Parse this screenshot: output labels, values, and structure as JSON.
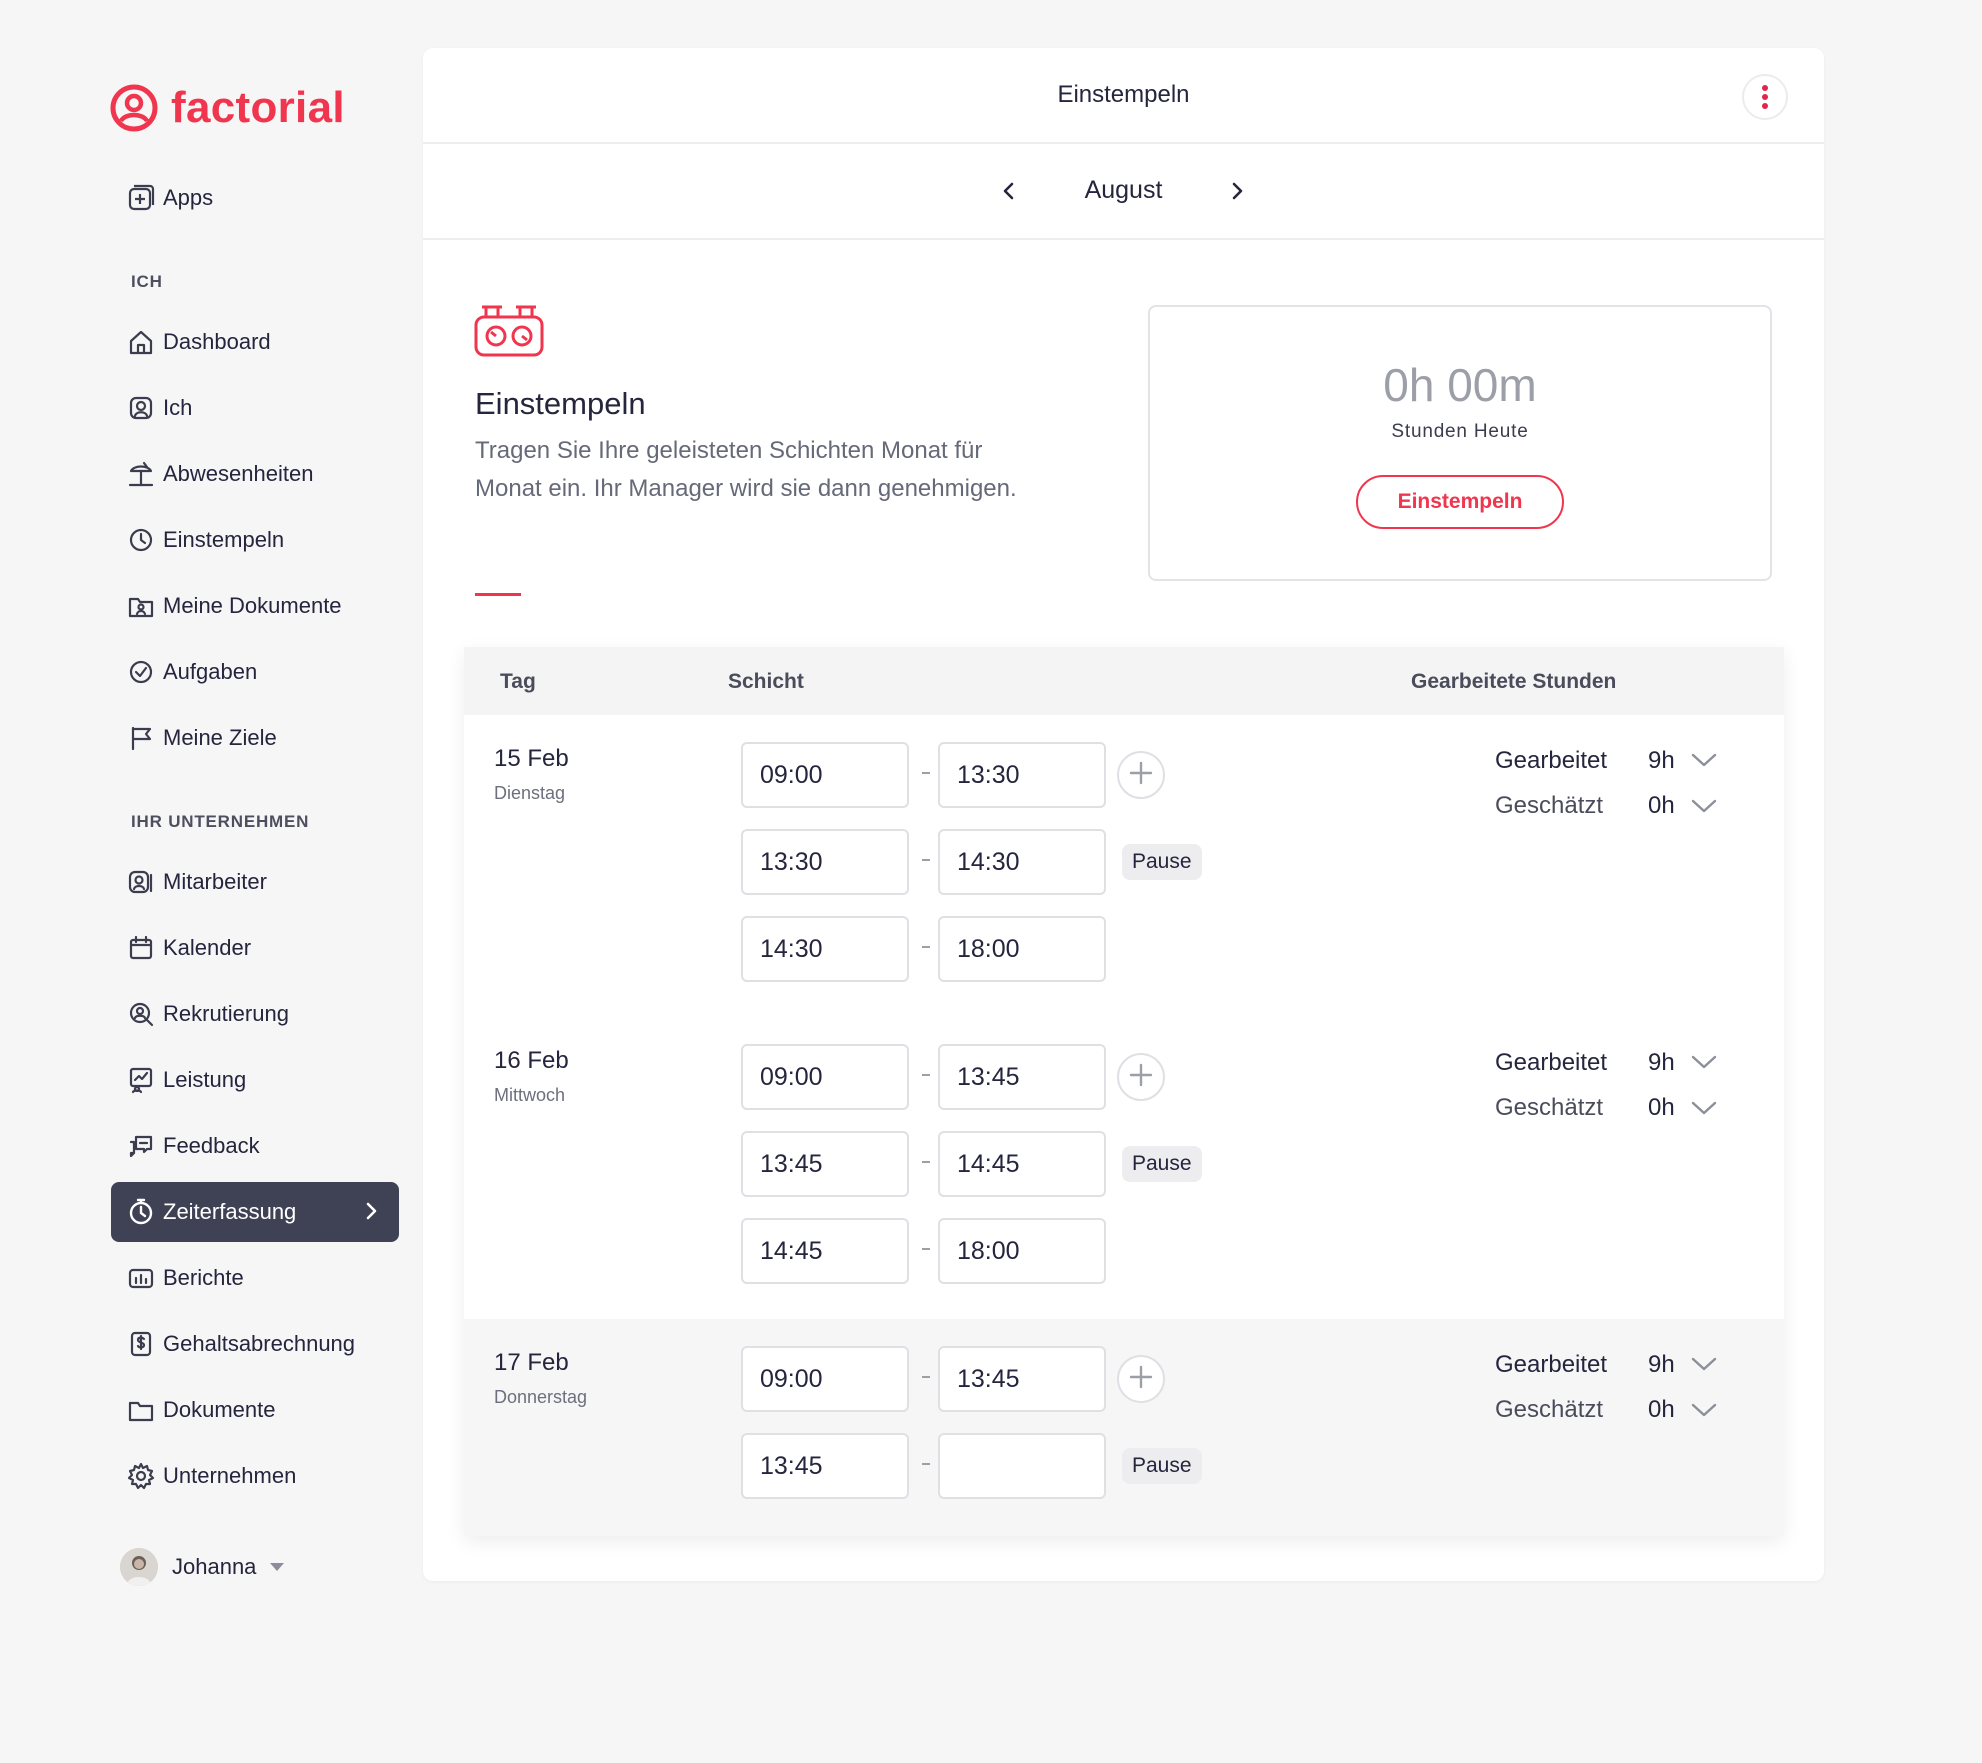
{
  "brand": {
    "name": "factorial",
    "color": "#f0364e"
  },
  "sidebar": {
    "apps": {
      "label": "Apps",
      "icon": "apps-plus-icon"
    },
    "section_me": "ICH",
    "me_items": [
      {
        "label": "Dashboard",
        "icon": "home-icon"
      },
      {
        "label": "Ich",
        "icon": "profile-icon"
      },
      {
        "label": "Abwesenheiten",
        "icon": "beach-icon"
      },
      {
        "label": "Einstempeln",
        "icon": "clock-icon"
      },
      {
        "label": "Meine Dokumente",
        "icon": "folder-user-icon"
      },
      {
        "label": "Aufgaben",
        "icon": "check-circle-icon"
      },
      {
        "label": "Meine Ziele",
        "icon": "flag-icon"
      }
    ],
    "section_company": "IHR UNTERNEHMEN",
    "company_items": [
      {
        "label": "Mitarbeiter",
        "icon": "employees-icon"
      },
      {
        "label": "Kalender",
        "icon": "calendar-icon"
      },
      {
        "label": "Rekrutierung",
        "icon": "recruiting-icon"
      },
      {
        "label": "Leistung",
        "icon": "performance-icon"
      },
      {
        "label": "Feedback",
        "icon": "feedback-icon"
      },
      {
        "label": "Zeiterfassung",
        "icon": "stopwatch-icon",
        "active": true
      },
      {
        "label": "Berichte",
        "icon": "reports-icon"
      },
      {
        "label": "Gehaltsabrechnung",
        "icon": "payroll-icon"
      },
      {
        "label": "Dokumente",
        "icon": "folder-icon"
      },
      {
        "label": "Unternehmen",
        "icon": "gear-icon"
      }
    ],
    "user": {
      "name": "Johanna"
    }
  },
  "header": {
    "title": "Einstempeln"
  },
  "month_nav": {
    "month": "August"
  },
  "intro": {
    "title": "Einstempeln",
    "text": "Tragen Sie Ihre geleisteten Schichten Monat für Monat ein. Ihr Manager wird sie dann genehmigen."
  },
  "today": {
    "hours": "0h 00m",
    "label": "Stunden Heute",
    "button": "Einstempeln"
  },
  "table": {
    "headers": {
      "day": "Tag",
      "shift": "Schicht",
      "hours": "Gearbeitete Stunden"
    },
    "days": [
      {
        "date": "15 Feb",
        "weekday": "Dienstag",
        "shifts": [
          [
            "09:00",
            "13:30"
          ],
          [
            "13:30",
            "14:30"
          ],
          [
            "14:30",
            "18:00"
          ]
        ],
        "pause_label": "Pause",
        "worked_label": "Gearbeitet",
        "worked": "9h",
        "estimated_label": "Geschätzt",
        "estimated": "0h"
      },
      {
        "date": "16 Feb",
        "weekday": "Mittwoch",
        "shifts": [
          [
            "09:00",
            "13:45"
          ],
          [
            "13:45",
            "14:45"
          ],
          [
            "14:45",
            "18:00"
          ]
        ],
        "pause_label": "Pause",
        "worked_label": "Gearbeitet",
        "worked": "9h",
        "estimated_label": "Geschätzt",
        "estimated": "0h"
      },
      {
        "date": "17 Feb",
        "weekday": "Donnerstag",
        "shifts": [
          [
            "09:00",
            "13:45"
          ],
          [
            "13:45",
            ""
          ]
        ],
        "pause_label": "Pause",
        "worked_label": "Gearbeitet",
        "worked": "9h",
        "estimated_label": "Geschätzt",
        "estimated": "0h"
      }
    ]
  }
}
